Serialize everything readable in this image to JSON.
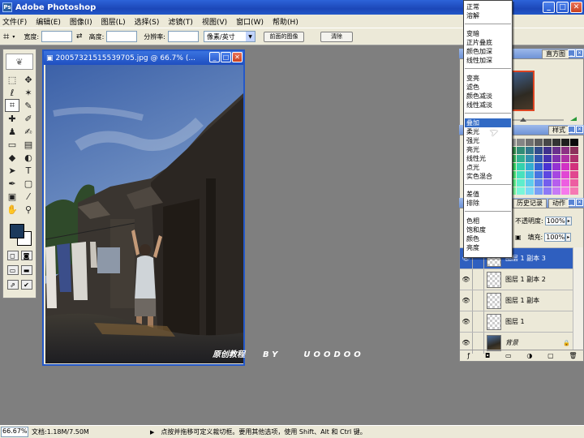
{
  "app": {
    "title": "Adobe Photoshop"
  },
  "menu": [
    "文件(F)",
    "编辑(E)",
    "图像(I)",
    "图层(L)",
    "选择(S)",
    "滤镜(T)",
    "视图(V)",
    "窗口(W)",
    "帮助(H)"
  ],
  "options": {
    "width_label": "宽度:",
    "height_label": "高度:",
    "resolution_label": "分辨率:",
    "unit_select": "像素/英寸",
    "front_image_button": "前面的图像",
    "clear_button": "清除"
  },
  "document": {
    "title": "20057321515539705.jpg @ 66.7% (..."
  },
  "watermark": {
    "part1": "原创教程",
    "part2": "BY",
    "part3": "UOODOO"
  },
  "panels": {
    "nav_tab": "直方图",
    "swatch_tab": "样式",
    "history_tab": "历史记录",
    "actions_tab": "动作",
    "opacity_label": "不透明度:",
    "opacity_value": "100%",
    "fill_label": "填充:",
    "fill_value": "100%"
  },
  "layers": [
    {
      "name": "图层 1 副本 3",
      "selected": true,
      "type": "transparent"
    },
    {
      "name": "图层 1 副本 2",
      "selected": false,
      "type": "transparent"
    },
    {
      "name": "图层 1 副本",
      "selected": false,
      "type": "transparent"
    },
    {
      "name": "图层 1",
      "selected": false,
      "type": "transparent"
    },
    {
      "name": "背景",
      "selected": false,
      "type": "photo",
      "locked": true
    }
  ],
  "blend_menu": {
    "groups": [
      [
        "正常",
        "溶解"
      ],
      [
        "变暗",
        "正片叠底",
        "颜色加深",
        "线性加深"
      ],
      [
        "变亮",
        "滤色",
        "颜色减淡",
        "线性减淡"
      ],
      [
        "叠加",
        "柔光",
        "强光",
        "亮光",
        "线性光",
        "点光",
        "实色混合"
      ],
      [
        "差值",
        "排除"
      ],
      [
        "色相",
        "饱和度",
        "颜色",
        "亮度"
      ]
    ],
    "highlighted": "叠加"
  },
  "status": {
    "zoom": "66.67%",
    "doc_info": "文档:1.18M/7.50M",
    "hint": "点按并拖移可定义裁切框。要用其他选项，使用 Shift、Alt 和 Ctrl 键。"
  },
  "colors": {
    "foreground": "#1c3a5c",
    "background": "#ffffff",
    "accent": "#316ac5"
  }
}
